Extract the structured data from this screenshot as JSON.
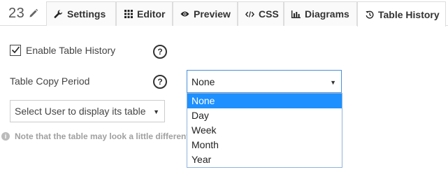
{
  "header": {
    "table_number": "23",
    "edit_icon": "pencil-icon"
  },
  "tabs": [
    {
      "label": "Settings",
      "icon": "wrench-icon",
      "active": false
    },
    {
      "label": "Editor",
      "icon": "grid-icon",
      "active": false
    },
    {
      "label": "Preview",
      "icon": "eye-icon",
      "active": false
    },
    {
      "label": "CSS",
      "icon": "code-icon",
      "active": false
    },
    {
      "label": "Diagrams",
      "icon": "bar-chart-icon",
      "active": false
    },
    {
      "label": "Table History",
      "icon": "history-icon",
      "active": true
    }
  ],
  "form": {
    "enable_history": {
      "label": "Enable Table History",
      "checked": true,
      "help": "?"
    },
    "copy_period": {
      "label": "Table Copy Period",
      "help": "?",
      "selected": "None",
      "options": [
        "None",
        "Day",
        "Week",
        "Month",
        "Year"
      ]
    },
    "user_select": {
      "value": "Select User to display its table"
    },
    "note": {
      "icon": "info-icon",
      "text": "Note that the table may look a little different"
    }
  },
  "colors": {
    "accent": "#1e90ff",
    "select_border": "#4a90d9",
    "tab_border": "#dddddd",
    "note_text": "#a0a0a0"
  }
}
